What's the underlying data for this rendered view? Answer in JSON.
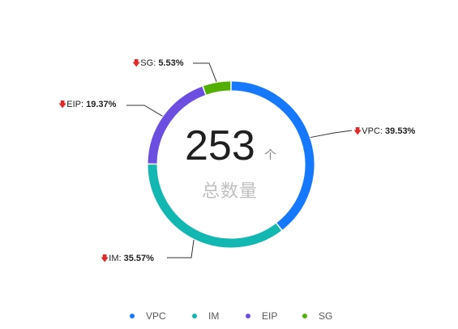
{
  "chart_data": {
    "type": "pie",
    "variant": "donut",
    "total": "253",
    "total_unit": "个",
    "total_label": "总数量",
    "legend_position": "bottom",
    "slices": [
      {
        "name": "VPC",
        "percent": 39.53,
        "percent_label": "39.53%",
        "trend": "down",
        "color": "#1677ff"
      },
      {
        "name": "IM",
        "percent": 35.57,
        "percent_label": "35.57%",
        "trend": "down",
        "color": "#13b7b1"
      },
      {
        "name": "EIP",
        "percent": 19.37,
        "percent_label": "19.37%",
        "trend": "down",
        "color": "#6c4fe0"
      },
      {
        "name": "SG",
        "percent": 5.53,
        "percent_label": "5.53%",
        "trend": "down",
        "color": "#52ae00"
      }
    ]
  },
  "trend_arrow_color": "#e02b2b",
  "trend_arrow_icon": "arrow-down-icon"
}
